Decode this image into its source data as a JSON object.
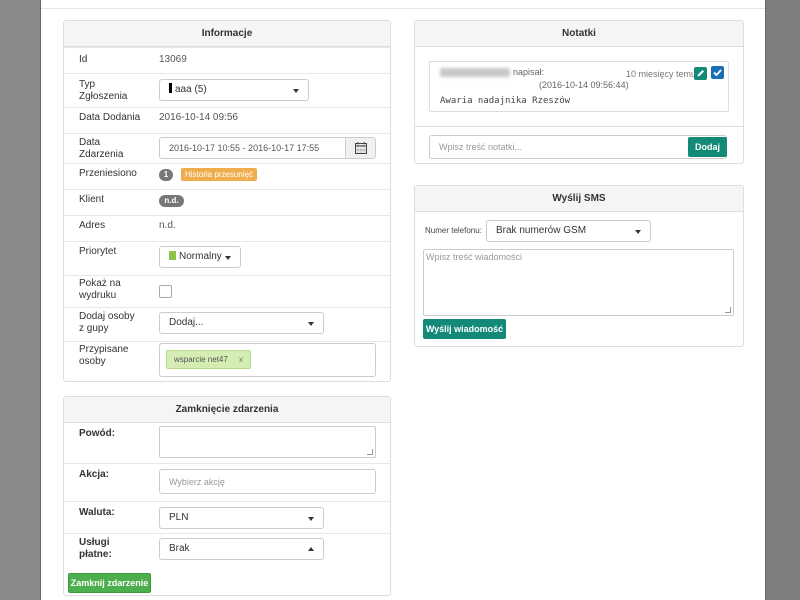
{
  "informacje": {
    "title": "Informacje",
    "id_label": "Id",
    "id_value": "13069",
    "typ_label": "Typ Zgłoszenia",
    "typ_value": "aaa (5)",
    "data_dodania_label": "Data Dodania",
    "data_dodania_value": "2016-10-14 09:56",
    "data_zdarzenia_label": "Data Zdarzenia",
    "data_zdarzenia_value": "2016-10-17 10:55 - 2016-10-17 17:55",
    "przeniesiono_label": "Przeniesiono",
    "przeniesiono_count": "1",
    "historia_label": "Historia przesunięć",
    "klient_label": "Klient",
    "klient_value": "n.d.",
    "adres_label": "Adres",
    "adres_value": "n.d.",
    "priorytet_label": "Priorytet",
    "priorytet_value": "Normalny",
    "priorytet_color": "#8bc34a",
    "pokaz_label": "Pokaż na wydruku",
    "dodaj_osoby_label": "Dodaj osoby z gupy",
    "dodaj_osoby_value": "Dodaj...",
    "przypisane_label": "Przypisane osoby",
    "przypisane_tag": "wsparcie net47",
    "przypisane_tag_remove": "x"
  },
  "zamkniecie": {
    "title": "Zamknięcie zdarzenia",
    "powod_label": "Powód:",
    "akcja_label": "Akcja:",
    "akcja_placeholder": "Wybierz akcję",
    "waluta_label": "Waluta:",
    "waluta_value": "PLN",
    "uslugi_label": "Usługi płatne:",
    "uslugi_value": "Brak",
    "submit_label": "Zamknij zdarzenie"
  },
  "notatki": {
    "title": "Notatki",
    "note_author_suffix": "napisał:",
    "note_time_ago": "10 miesięcy temu",
    "note_date": "(2016-10-14 09:56:44)",
    "note_text": "Awaria nadajnika Rzeszów",
    "input_placeholder": "Wpisz treść notatki...",
    "add_label": "Dodaj"
  },
  "sms": {
    "title": "Wyślij SMS",
    "phone_label": "Numer telefonu:",
    "phone_value": "Brak numerów GSM",
    "message_placeholder": "Wpisz treść wiadomości",
    "send_label": "Wyślij wiadomość"
  },
  "colors": {
    "teal": "#138a78",
    "green": "#4cae4c",
    "orange": "#f0ad4e",
    "tag_green_bg": "#d4edb3"
  }
}
